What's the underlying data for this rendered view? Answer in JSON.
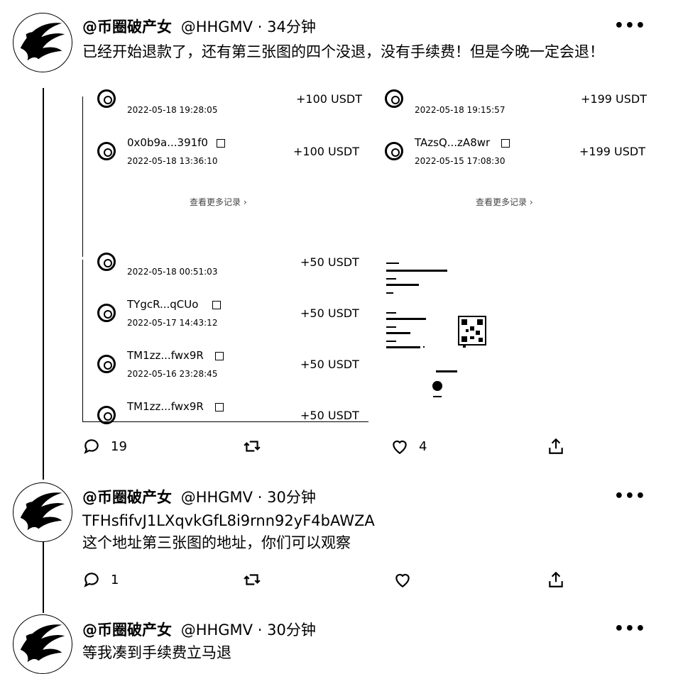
{
  "tweets": [
    {
      "name": "@币圈破产女",
      "handle": "@HHGMV",
      "time": "34分钟",
      "text": "已经开始退款了，还有第三张图的四个没退，没有手续费！但是今晚一定会退！",
      "replies": "19",
      "retweets": "",
      "likes": "4"
    },
    {
      "name": "@币圈破产女",
      "handle": "@HHGMV",
      "time": "30分钟",
      "text_line1": "TFHsfifvJ1LXqvkGfL8i9rnn92yF4bAWZA",
      "text_line2": "这个地址第三张图的地址，你们可以观察",
      "replies": "1",
      "retweets": "",
      "likes": ""
    },
    {
      "name": "@币圈破产女",
      "handle": "@HHGMV",
      "time": "30分钟",
      "text": "等我凑到手续费立马退"
    }
  ],
  "separator": "·",
  "more_icon": "•••",
  "media": {
    "panel1": {
      "top_date": "2022-05-18 19:28:05",
      "top_amount": "+100 USDT",
      "addr": "0x0b9a...391f0",
      "date": "2022-05-18 13:36:10",
      "amount": "+100 USDT",
      "more": "查看更多记录 ›"
    },
    "panel2": {
      "top_date": "2022-05-18 19:15:57",
      "top_amount": "+199 USDT",
      "addr": "TAzsQ...zA8wr",
      "date": "2022-05-15 17:08:30",
      "amount": "+199 USDT",
      "more": "查看更多记录 ›"
    },
    "panel3": {
      "top_date": "2022-05-18 00:51:03",
      "top_amount": "+50 USDT",
      "rows": [
        {
          "addr": "TYgcR...qCUo",
          "date": "2022-05-17 14:43:12",
          "amount": "+50 USDT"
        },
        {
          "addr": "TM1zz...fwx9R",
          "date": "2022-05-16 23:28:45",
          "amount": "+50 USDT"
        },
        {
          "addr": "TM1zz...fwx9R",
          "date": "",
          "amount": "+50 USDT"
        }
      ]
    }
  }
}
